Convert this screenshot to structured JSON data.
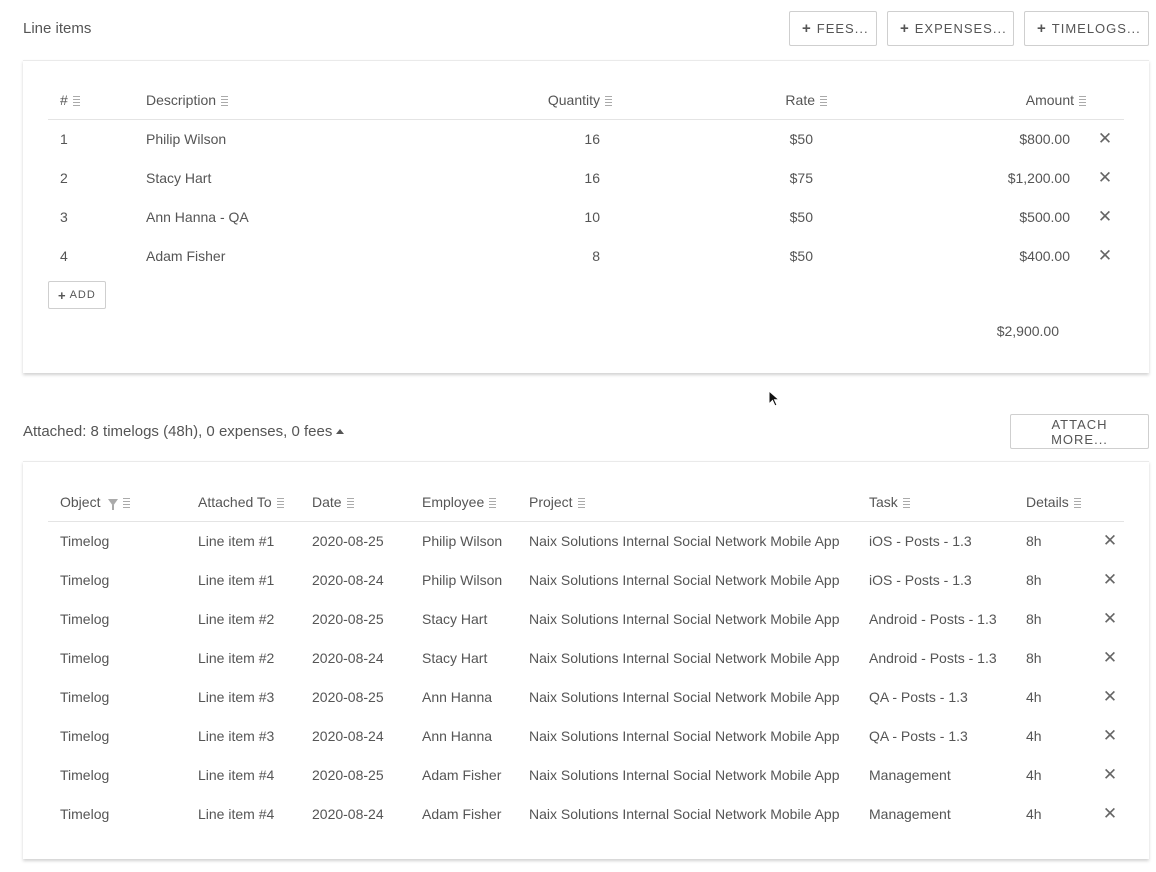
{
  "line_items": {
    "title": "Line items",
    "buttons": {
      "fees": "FEES...",
      "expenses": "EXPENSES...",
      "timelogs": "TIMELOGS..."
    },
    "columns": {
      "num": "#",
      "description": "Description",
      "quantity": "Quantity",
      "rate": "Rate",
      "amount": "Amount"
    },
    "rows": [
      {
        "num": "1",
        "description": "Philip Wilson",
        "quantity": "16",
        "rate": "$50",
        "amount": "$800.00"
      },
      {
        "num": "2",
        "description": "Stacy Hart",
        "quantity": "16",
        "rate": "$75",
        "amount": "$1,200.00"
      },
      {
        "num": "3",
        "description": "Ann Hanna - QA",
        "quantity": "10",
        "rate": "$50",
        "amount": "$500.00"
      },
      {
        "num": "4",
        "description": "Adam Fisher",
        "quantity": "8",
        "rate": "$50",
        "amount": "$400.00"
      }
    ],
    "add_label": "ADD",
    "total": "$2,900.00"
  },
  "attached": {
    "summary": "Attached: 8 timelogs (48h), 0 expenses, 0 fees",
    "attach_more": "ATTACH MORE...",
    "columns": {
      "object": "Object",
      "attached_to": "Attached To",
      "date": "Date",
      "employee": "Employee",
      "project": "Project",
      "task": "Task",
      "details": "Details"
    },
    "rows": [
      {
        "object": "Timelog",
        "attached_to": "Line item #1",
        "date": "2020-08-25",
        "employee": "Philip Wilson",
        "project": "Naix Solutions Internal Social Network Mobile App",
        "task": "iOS - Posts - 1.3",
        "details": "8h"
      },
      {
        "object": "Timelog",
        "attached_to": "Line item #1",
        "date": "2020-08-24",
        "employee": "Philip Wilson",
        "project": "Naix Solutions Internal Social Network Mobile App",
        "task": "iOS - Posts - 1.3",
        "details": "8h"
      },
      {
        "object": "Timelog",
        "attached_to": "Line item #2",
        "date": "2020-08-25",
        "employee": "Stacy Hart",
        "project": "Naix Solutions Internal Social Network Mobile App",
        "task": "Android - Posts - 1.3",
        "details": "8h"
      },
      {
        "object": "Timelog",
        "attached_to": "Line item #2",
        "date": "2020-08-24",
        "employee": "Stacy Hart",
        "project": "Naix Solutions Internal Social Network Mobile App",
        "task": "Android - Posts - 1.3",
        "details": "8h"
      },
      {
        "object": "Timelog",
        "attached_to": "Line item #3",
        "date": "2020-08-25",
        "employee": "Ann Hanna",
        "project": "Naix Solutions Internal Social Network Mobile App",
        "task": "QA - Posts - 1.3",
        "details": "4h"
      },
      {
        "object": "Timelog",
        "attached_to": "Line item #3",
        "date": "2020-08-24",
        "employee": "Ann Hanna",
        "project": "Naix Solutions Internal Social Network Mobile App",
        "task": "QA - Posts - 1.3",
        "details": "4h"
      },
      {
        "object": "Timelog",
        "attached_to": "Line item #4",
        "date": "2020-08-25",
        "employee": "Adam Fisher",
        "project": "Naix Solutions Internal Social Network Mobile App",
        "task": "Management",
        "details": "4h"
      },
      {
        "object": "Timelog",
        "attached_to": "Line item #4",
        "date": "2020-08-24",
        "employee": "Adam Fisher",
        "project": "Naix Solutions Internal Social Network Mobile App",
        "task": "Management",
        "details": "4h"
      }
    ]
  },
  "icons": {
    "plus": "plus-icon",
    "remove": "close-icon",
    "column_menu": "column-menu-icon",
    "filter": "filter-icon",
    "toggle": "caret-up-icon",
    "pointer": "mouse-pointer-icon"
  },
  "colors": {
    "text": "#555555",
    "border": "#cfcfcf"
  }
}
